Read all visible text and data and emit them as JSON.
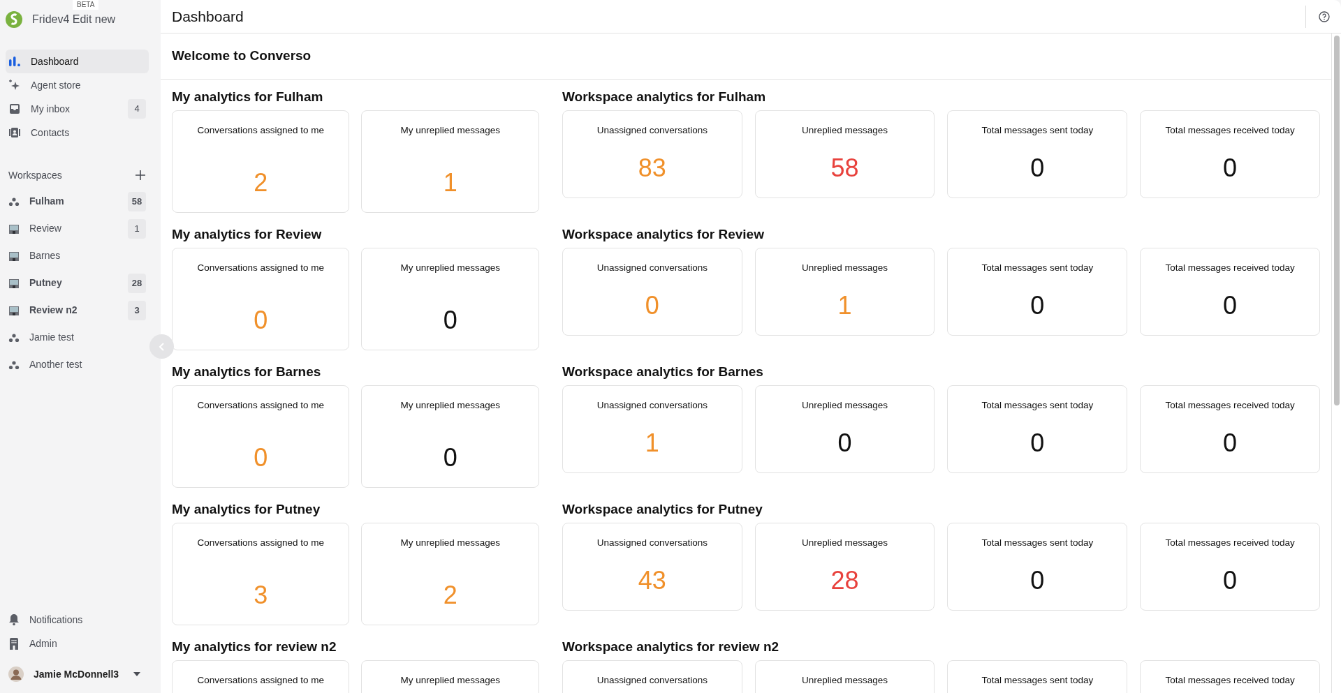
{
  "app": {
    "name": "Fridev4 Edit new",
    "tag": "BETA"
  },
  "nav": [
    {
      "label": "Dashboard",
      "kind": "chart",
      "selected": true
    },
    {
      "label": "Agent store",
      "kind": "sparkle",
      "selected": false
    },
    {
      "label": "My inbox",
      "kind": "inbox",
      "badge": "4",
      "selected": false
    },
    {
      "label": "Contacts",
      "kind": "contacts",
      "selected": false
    }
  ],
  "workspaces": {
    "title": "Workspaces",
    "items": [
      {
        "label": "Fulham",
        "kind": "team",
        "unread": true,
        "badge": "58"
      },
      {
        "label": "Review",
        "kind": "building",
        "unread": false,
        "badge": "1"
      },
      {
        "label": "Barnes",
        "kind": "building",
        "unread": false
      },
      {
        "label": "Putney",
        "kind": "building",
        "unread": true,
        "badge": "28"
      },
      {
        "label": "Review n2",
        "kind": "building",
        "unread": true,
        "badge": "3"
      },
      {
        "label": "Jamie test",
        "kind": "team",
        "unread": false
      },
      {
        "label": "Another test",
        "kind": "team",
        "unread": false
      }
    ]
  },
  "footer_nav": [
    {
      "label": "Notifications",
      "kind": "bell"
    },
    {
      "label": "Admin",
      "kind": "office"
    }
  ],
  "user": {
    "name": "Jamie McDonnell3"
  },
  "header": {
    "title": "Dashboard"
  },
  "welcome": "Welcome to Converso",
  "sections": [
    {
      "my": {
        "title": "My analytics for Fulham",
        "cards": [
          {
            "label": "Conversations assigned to me",
            "value": "2",
            "color": "#f0902a"
          },
          {
            "label": "My unreplied messages",
            "value": "1",
            "color": "#f0902a"
          }
        ]
      },
      "workspace": {
        "title": "Workspace analytics for Fulham",
        "cards": [
          {
            "label": "Unassigned conversations",
            "value": "83",
            "color": "#f0902a"
          },
          {
            "label": "Unreplied messages",
            "value": "58",
            "color": "#e8413c"
          },
          {
            "label": "Total messages sent today",
            "value": "0",
            "color": "#111111"
          },
          {
            "label": "Total messages received today",
            "value": "0",
            "color": "#111111"
          }
        ]
      }
    },
    {
      "my": {
        "title": "My analytics for Review",
        "cards": [
          {
            "label": "Conversations assigned to me",
            "value": "0",
            "color": "#f0902a"
          },
          {
            "label": "My unreplied messages",
            "value": "0",
            "color": "#111111"
          }
        ]
      },
      "workspace": {
        "title": "Workspace analytics for Review",
        "cards": [
          {
            "label": "Unassigned conversations",
            "value": "0",
            "color": "#f0902a"
          },
          {
            "label": "Unreplied messages",
            "value": "1",
            "color": "#f0902a"
          },
          {
            "label": "Total messages sent today",
            "value": "0",
            "color": "#111111"
          },
          {
            "label": "Total messages received today",
            "value": "0",
            "color": "#111111"
          }
        ]
      }
    },
    {
      "my": {
        "title": "My analytics for Barnes",
        "cards": [
          {
            "label": "Conversations assigned to me",
            "value": "0",
            "color": "#f0902a"
          },
          {
            "label": "My unreplied messages",
            "value": "0",
            "color": "#111111"
          }
        ]
      },
      "workspace": {
        "title": "Workspace analytics for Barnes",
        "cards": [
          {
            "label": "Unassigned conversations",
            "value": "1",
            "color": "#f0902a"
          },
          {
            "label": "Unreplied messages",
            "value": "0",
            "color": "#111111"
          },
          {
            "label": "Total messages sent today",
            "value": "0",
            "color": "#111111"
          },
          {
            "label": "Total messages received today",
            "value": "0",
            "color": "#111111"
          }
        ]
      }
    },
    {
      "my": {
        "title": "My analytics for Putney",
        "cards": [
          {
            "label": "Conversations assigned to me",
            "value": "3",
            "color": "#f0902a"
          },
          {
            "label": "My unreplied messages",
            "value": "2",
            "color": "#f0902a"
          }
        ]
      },
      "workspace": {
        "title": "Workspace analytics for Putney",
        "cards": [
          {
            "label": "Unassigned conversations",
            "value": "43",
            "color": "#f0902a"
          },
          {
            "label": "Unreplied messages",
            "value": "28",
            "color": "#e8413c"
          },
          {
            "label": "Total messages sent today",
            "value": "0",
            "color": "#111111"
          },
          {
            "label": "Total messages received today",
            "value": "0",
            "color": "#111111"
          }
        ]
      }
    },
    {
      "my": {
        "title": "My analytics for review n2",
        "cards": [
          {
            "label": "Conversations assigned to me"
          },
          {
            "label": "My unreplied messages"
          }
        ]
      },
      "workspace": {
        "title": "Workspace analytics for review n2",
        "cards": [
          {
            "label": "Unassigned conversations"
          },
          {
            "label": "Unreplied messages"
          },
          {
            "label": "Total messages sent today"
          },
          {
            "label": "Total messages received today"
          }
        ]
      }
    }
  ]
}
